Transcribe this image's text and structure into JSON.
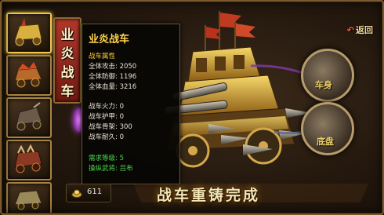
{
  "header": {
    "return_label": "返回"
  },
  "chariot_tab": {
    "chars": [
      "业",
      "炎",
      "战",
      "车"
    ]
  },
  "slots": [
    {
      "name": "chariot-slot",
      "active": true
    },
    {
      "name": "chariot-slot",
      "active": false
    },
    {
      "name": "chariot-slot",
      "active": false
    },
    {
      "name": "chariot-slot",
      "active": false
    },
    {
      "name": "chariot-slot",
      "active": false
    }
  ],
  "tooltip": {
    "title": "业炎战车",
    "rows": [
      {
        "text": "战车属性",
        "style": "attr"
      },
      {
        "text": "全体攻击: 2050",
        "style": "white"
      },
      {
        "text": "全体防御: 1196",
        "style": "white"
      },
      {
        "text": "全体血量: 3216",
        "style": "white"
      },
      {
        "text": "战车火力: 0",
        "style": "white"
      },
      {
        "text": "战车护甲: 0",
        "style": "white"
      },
      {
        "text": "战车骨架: 300",
        "style": "white"
      },
      {
        "text": "战车耐久: 0",
        "style": "white"
      },
      {
        "text": "需求等级: 5",
        "style": "green"
      },
      {
        "text": "操纵武将: 吕布",
        "style": "green"
      }
    ]
  },
  "parts": [
    {
      "label": "车身"
    },
    {
      "label": "底盘"
    }
  ],
  "gold": {
    "value": "611"
  },
  "banner": {
    "text": "战车重铸完成"
  },
  "colors": {
    "accent": "#f0c64a",
    "tooltip_title": "#ffd34a",
    "stat_green": "#4ad64a",
    "tab_red": "#b2372a"
  }
}
